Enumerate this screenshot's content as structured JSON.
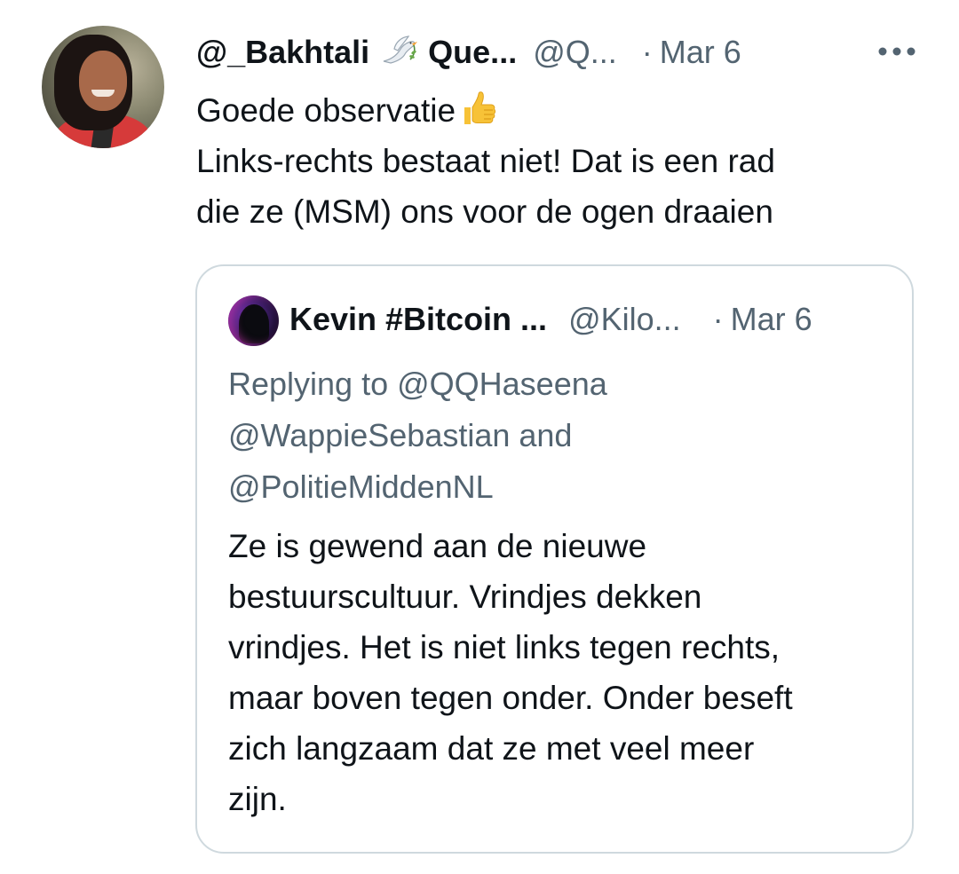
{
  "tweet": {
    "author_name": "@_Bakhtali",
    "author_name_suffix": "Que...",
    "author_handle": "@Q...",
    "separator": "·",
    "date": "Mar 6",
    "text_lines": [
      "Goede observatie",
      "Links-rechts bestaat niet! Dat is een rad",
      "die ze (MSM) ons voor de ogen draaien"
    ],
    "more_icon": "more-horizontal-icon",
    "name_emoji_icon": "dove-of-peace-icon",
    "text_emoji_icon": "thumbs-up-icon"
  },
  "quote": {
    "author_name": "Kevin #Bitcoin ...",
    "author_handle": "@Kilo...",
    "separator": "·",
    "date": "Mar 6",
    "replying_lines": [
      "Replying to @QQHaseena",
      "@WappieSebastian and",
      "@PolitieMiddenNL"
    ],
    "text_lines": [
      "Ze is gewend aan de nieuwe",
      "bestuurscultuur. Vrindjes dekken",
      "vrindjes. Het is niet links tegen rechts,",
      "maar boven tegen onder. Onder beseft",
      "zich langzaam dat ze met veel meer",
      "zijn."
    ]
  },
  "colors": {
    "primary_text": "#0f1419",
    "secondary_text": "#536471",
    "border": "#cfd9de",
    "background": "#ffffff"
  }
}
